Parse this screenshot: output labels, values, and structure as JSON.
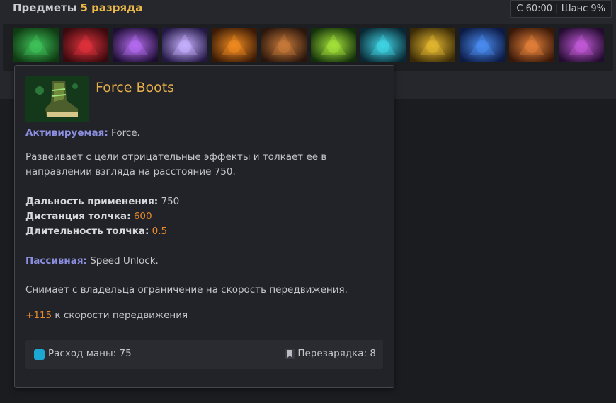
{
  "header": {
    "title_prefix": "Предметы",
    "title_tier": "5 разряда",
    "chance": "С 60:00 | Шанс 9%"
  },
  "items": [
    {
      "name": "force-boots-thumb",
      "colors": [
        "#0f3a12",
        "#3fc25a"
      ]
    },
    {
      "name": "item-2-thumb",
      "colors": [
        "#3a0a0e",
        "#e0323c"
      ]
    },
    {
      "name": "item-3-thumb",
      "colors": [
        "#1d0e33",
        "#b46cf0"
      ]
    },
    {
      "name": "item-4-thumb",
      "colors": [
        "#241845",
        "#c6b0ff"
      ]
    },
    {
      "name": "item-5-thumb",
      "colors": [
        "#3a1a06",
        "#f08a20"
      ]
    },
    {
      "name": "item-6-thumb",
      "colors": [
        "#2a160c",
        "#c87a3a"
      ]
    },
    {
      "name": "item-7-thumb",
      "colors": [
        "#12300a",
        "#a4e23a"
      ]
    },
    {
      "name": "item-8-thumb",
      "colors": [
        "#0a2834",
        "#40d6e6"
      ]
    },
    {
      "name": "item-9-thumb",
      "colors": [
        "#3a2a06",
        "#e2b630"
      ]
    },
    {
      "name": "item-10-thumb",
      "colors": [
        "#0c1a44",
        "#4a8cf0"
      ]
    },
    {
      "name": "item-11-thumb",
      "colors": [
        "#3a1808",
        "#e2803a"
      ]
    },
    {
      "name": "item-12-thumb",
      "colors": [
        "#240c30",
        "#c25ad8"
      ]
    }
  ],
  "tooltip": {
    "title": "Force Boots",
    "active_label": "Активируемая:",
    "active_name": "Force.",
    "active_desc": "Развеивает с цели отрицательные эффекты и толкает ее в направлении взгляда на расстояние 750.",
    "stats": [
      {
        "label": "Дальность применения:",
        "value": "750",
        "highlight": false
      },
      {
        "label": "Дистанция толчка:",
        "value": "600",
        "highlight": true
      },
      {
        "label": "Длительность толчка:",
        "value": "0.5",
        "highlight": true
      }
    ],
    "passive_label": "Пассивная:",
    "passive_name": "Speed Unlock.",
    "passive_desc": "Снимает с владельца ограничение на скорость передвижения.",
    "bonus_sign": "+",
    "bonus_value": "115",
    "bonus_text": " к скорости передвижения",
    "mana_label": "Расход маны: 75",
    "cooldown_label": "Перезарядка: 8"
  }
}
